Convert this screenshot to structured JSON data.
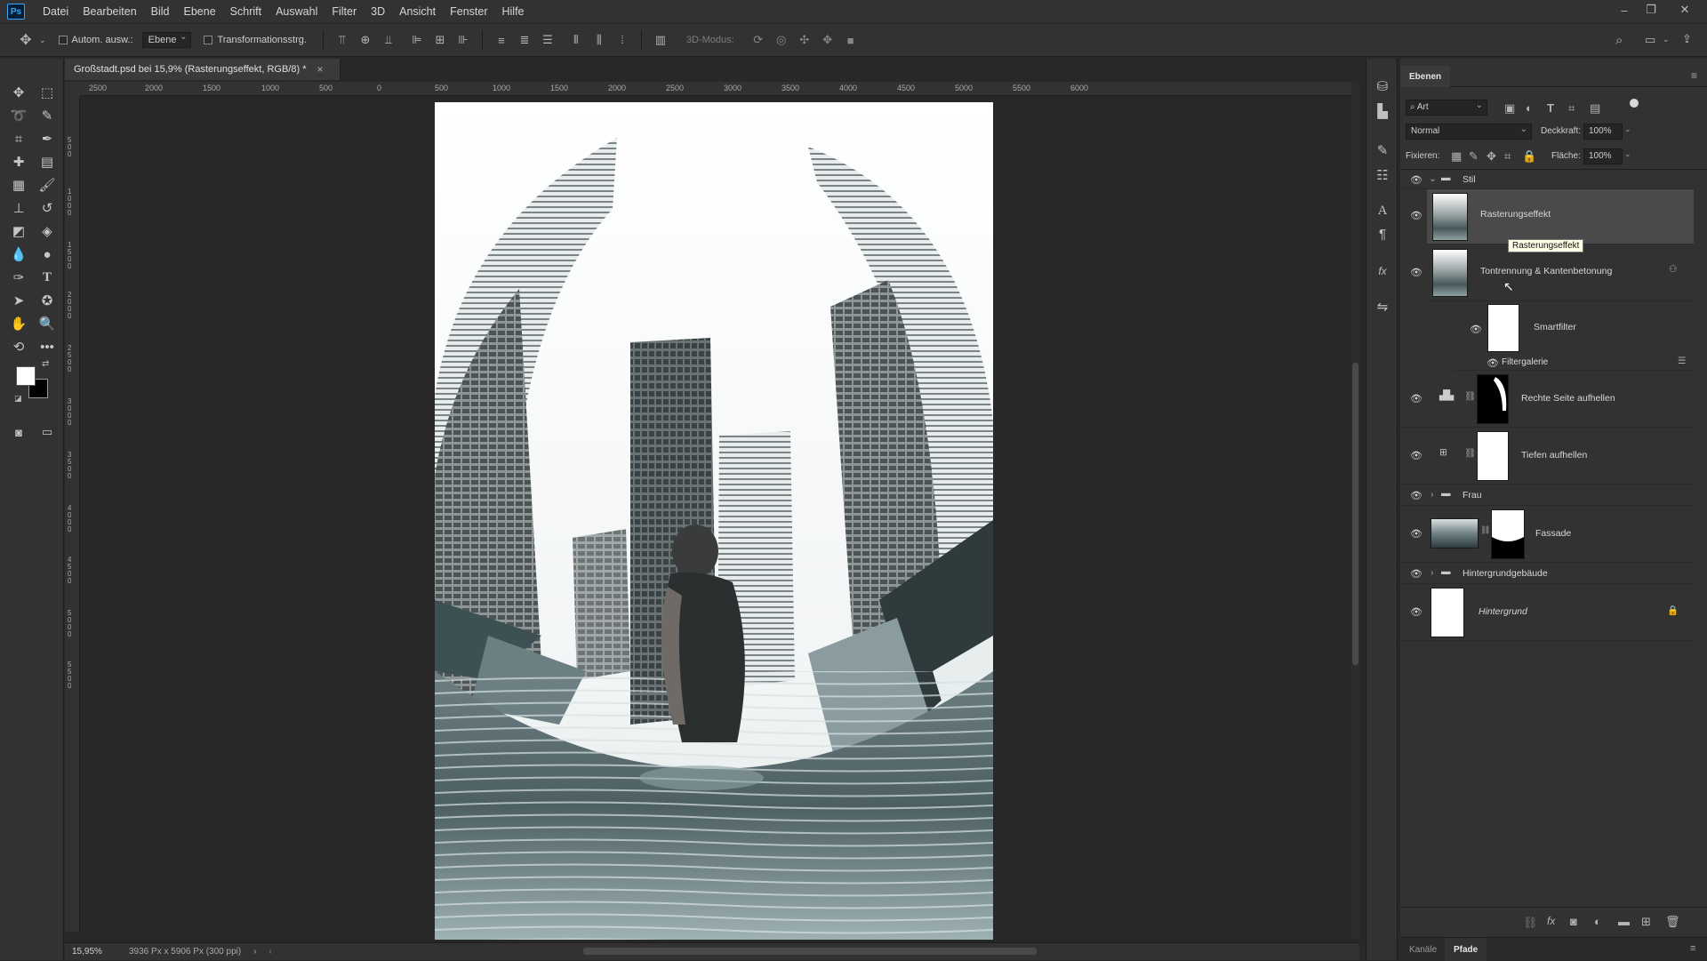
{
  "app": {
    "logo": "Ps"
  },
  "menu": [
    "Datei",
    "Bearbeiten",
    "Bild",
    "Ebene",
    "Schrift",
    "Auswahl",
    "Filter",
    "3D",
    "Ansicht",
    "Fenster",
    "Hilfe"
  ],
  "options": {
    "auto_select_label": "Autom. ausw.:",
    "auto_select_value": "Ebene",
    "transform_label": "Transformationsstrg.",
    "mode3d_label": "3D-Modus:"
  },
  "document": {
    "tab_title": "Großstadt.psd bei 15,9% (Rasterungseffekt, RGB/8) *",
    "close_glyph": "×",
    "zoom": "15,95%",
    "doc_info": "3936 Px x 5906 Px (300 ppi)"
  },
  "ruler": {
    "h_labels": [
      "2500",
      "2000",
      "1500",
      "1000",
      "500",
      "0",
      "500",
      "1000",
      "1500",
      "2000",
      "2500",
      "3000",
      "3500",
      "4000",
      "4500",
      "5000",
      "5500",
      "6000"
    ],
    "v_labels": [
      "0",
      "5 0 0",
      "1 0 0 0",
      "1 5 0 0",
      "2 0 0 0",
      "2 5 0 0",
      "3 0 0 0",
      "3 5 0 0",
      "4 0 0 0",
      "4 5 0 0",
      "5 0 0 0",
      "5 5 0 0"
    ]
  },
  "layers_panel": {
    "tab": "Ebenen",
    "filter_kind": "Art",
    "blend_mode": "Normal",
    "opacity_label": "Deckkraft:",
    "opacity_value": "100%",
    "lock_label": "Fixieren:",
    "fill_label": "Fläche:",
    "fill_value": "100%",
    "tooltip": "Rasterungseffekt",
    "layers": {
      "group_stil": "Stil",
      "rasterungseffekt": "Rasterungseffekt",
      "tontrennung": "Tontrennung & Kantenbetonung",
      "smartfilter": "Smartfilter",
      "filtergalerie": "Filtergalerie",
      "rechte_seite": "Rechte Seite aufhellen",
      "tiefen": "Tiefen aufhellen",
      "group_frau": "Frau",
      "fassade": "Fassade",
      "group_hintergrundgebaeude": "Hintergrundgebäude",
      "hintergrund": "Hintergrund"
    },
    "bottom_tabs": [
      "Kanäle",
      "Pfade"
    ]
  },
  "colors": {
    "chrome": "#323232",
    "canvas_bg": "#282828",
    "selected_row": "#4a4a4a",
    "accent": "#31a8ff"
  }
}
